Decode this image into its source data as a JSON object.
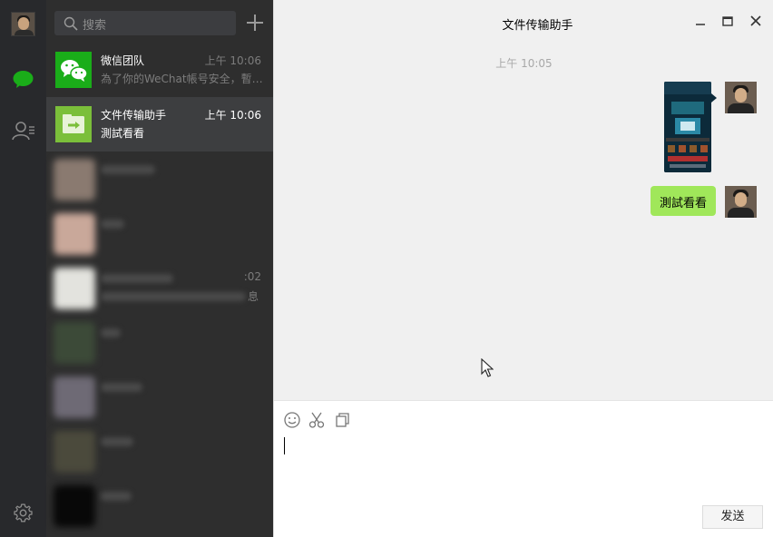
{
  "window": {
    "title": "文件传输助手"
  },
  "search": {
    "placeholder": "搜索"
  },
  "chats": [
    {
      "name": "微信团队",
      "time": "上午 10:06",
      "preview": "為了你的WeChat帳号安全，暫…",
      "active": false
    },
    {
      "name": "文件传输助手",
      "time": "上午 10:06",
      "preview": "測試看看",
      "active": true
    },
    {
      "name": "",
      "time": "",
      "preview": "",
      "blurred": true
    },
    {
      "name": "",
      "time": "",
      "preview": "",
      "blurred": true
    },
    {
      "name": "",
      "time": ":02",
      "preview": "息",
      "blurred": true
    },
    {
      "name": "",
      "time": "",
      "preview": "",
      "blurred": true
    },
    {
      "name": "",
      "time": "",
      "preview": "",
      "blurred": true
    },
    {
      "name": "",
      "time": "",
      "preview": "",
      "blurred": true
    },
    {
      "name": "",
      "time": "",
      "preview": "",
      "blurred": true
    }
  ],
  "conversation": {
    "timestamp": "上午 10:05",
    "text_message": "測試看看"
  },
  "composer": {
    "send_label": "发送"
  },
  "colors": {
    "accent_green": "#1aad19",
    "bubble_green": "#a0e75a",
    "sidebar_bg": "#2e2e2e",
    "rail_bg": "#28292c"
  },
  "icons": [
    "chat-icon",
    "contacts-icon",
    "settings-icon",
    "search-icon",
    "plus-icon",
    "minimize-icon",
    "maximize-icon",
    "close-icon",
    "emoji-icon",
    "scissors-icon",
    "file-icon"
  ]
}
